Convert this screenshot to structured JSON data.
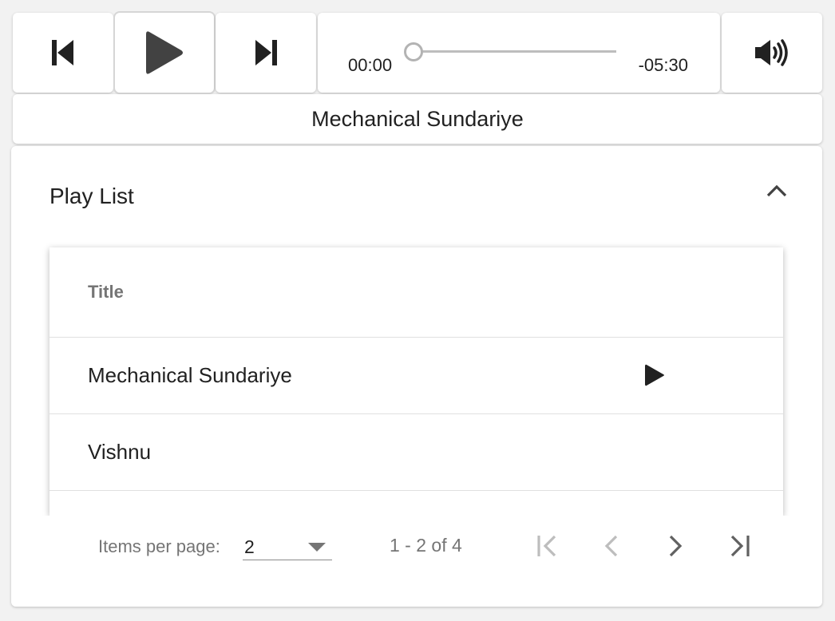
{
  "player": {
    "time_current": "00:00",
    "time_remaining": "-05:30",
    "progress": 0,
    "now_playing": "Mechanical Sundariye",
    "icons": {
      "previous": "skip-previous-icon",
      "play": "play-icon",
      "next": "skip-next-icon",
      "volume": "volume-up-icon"
    }
  },
  "playlist": {
    "title": "Play List",
    "collapse_icon": "chevron-up-icon",
    "table": {
      "columns": [
        "Title"
      ],
      "rows": [
        {
          "title": "Mechanical Sundariye",
          "is_current": true
        },
        {
          "title": "Vishnu",
          "is_current": false
        }
      ]
    },
    "paginator": {
      "items_per_page_label": "Items per page:",
      "items_per_page": "2",
      "range_label": "1 - 2 of 4"
    }
  },
  "colors": {
    "background": "#f2f2f2",
    "card": "#ffffff",
    "icon": "#212121",
    "muted": "#757575",
    "disabled": "#bdbdbd"
  }
}
